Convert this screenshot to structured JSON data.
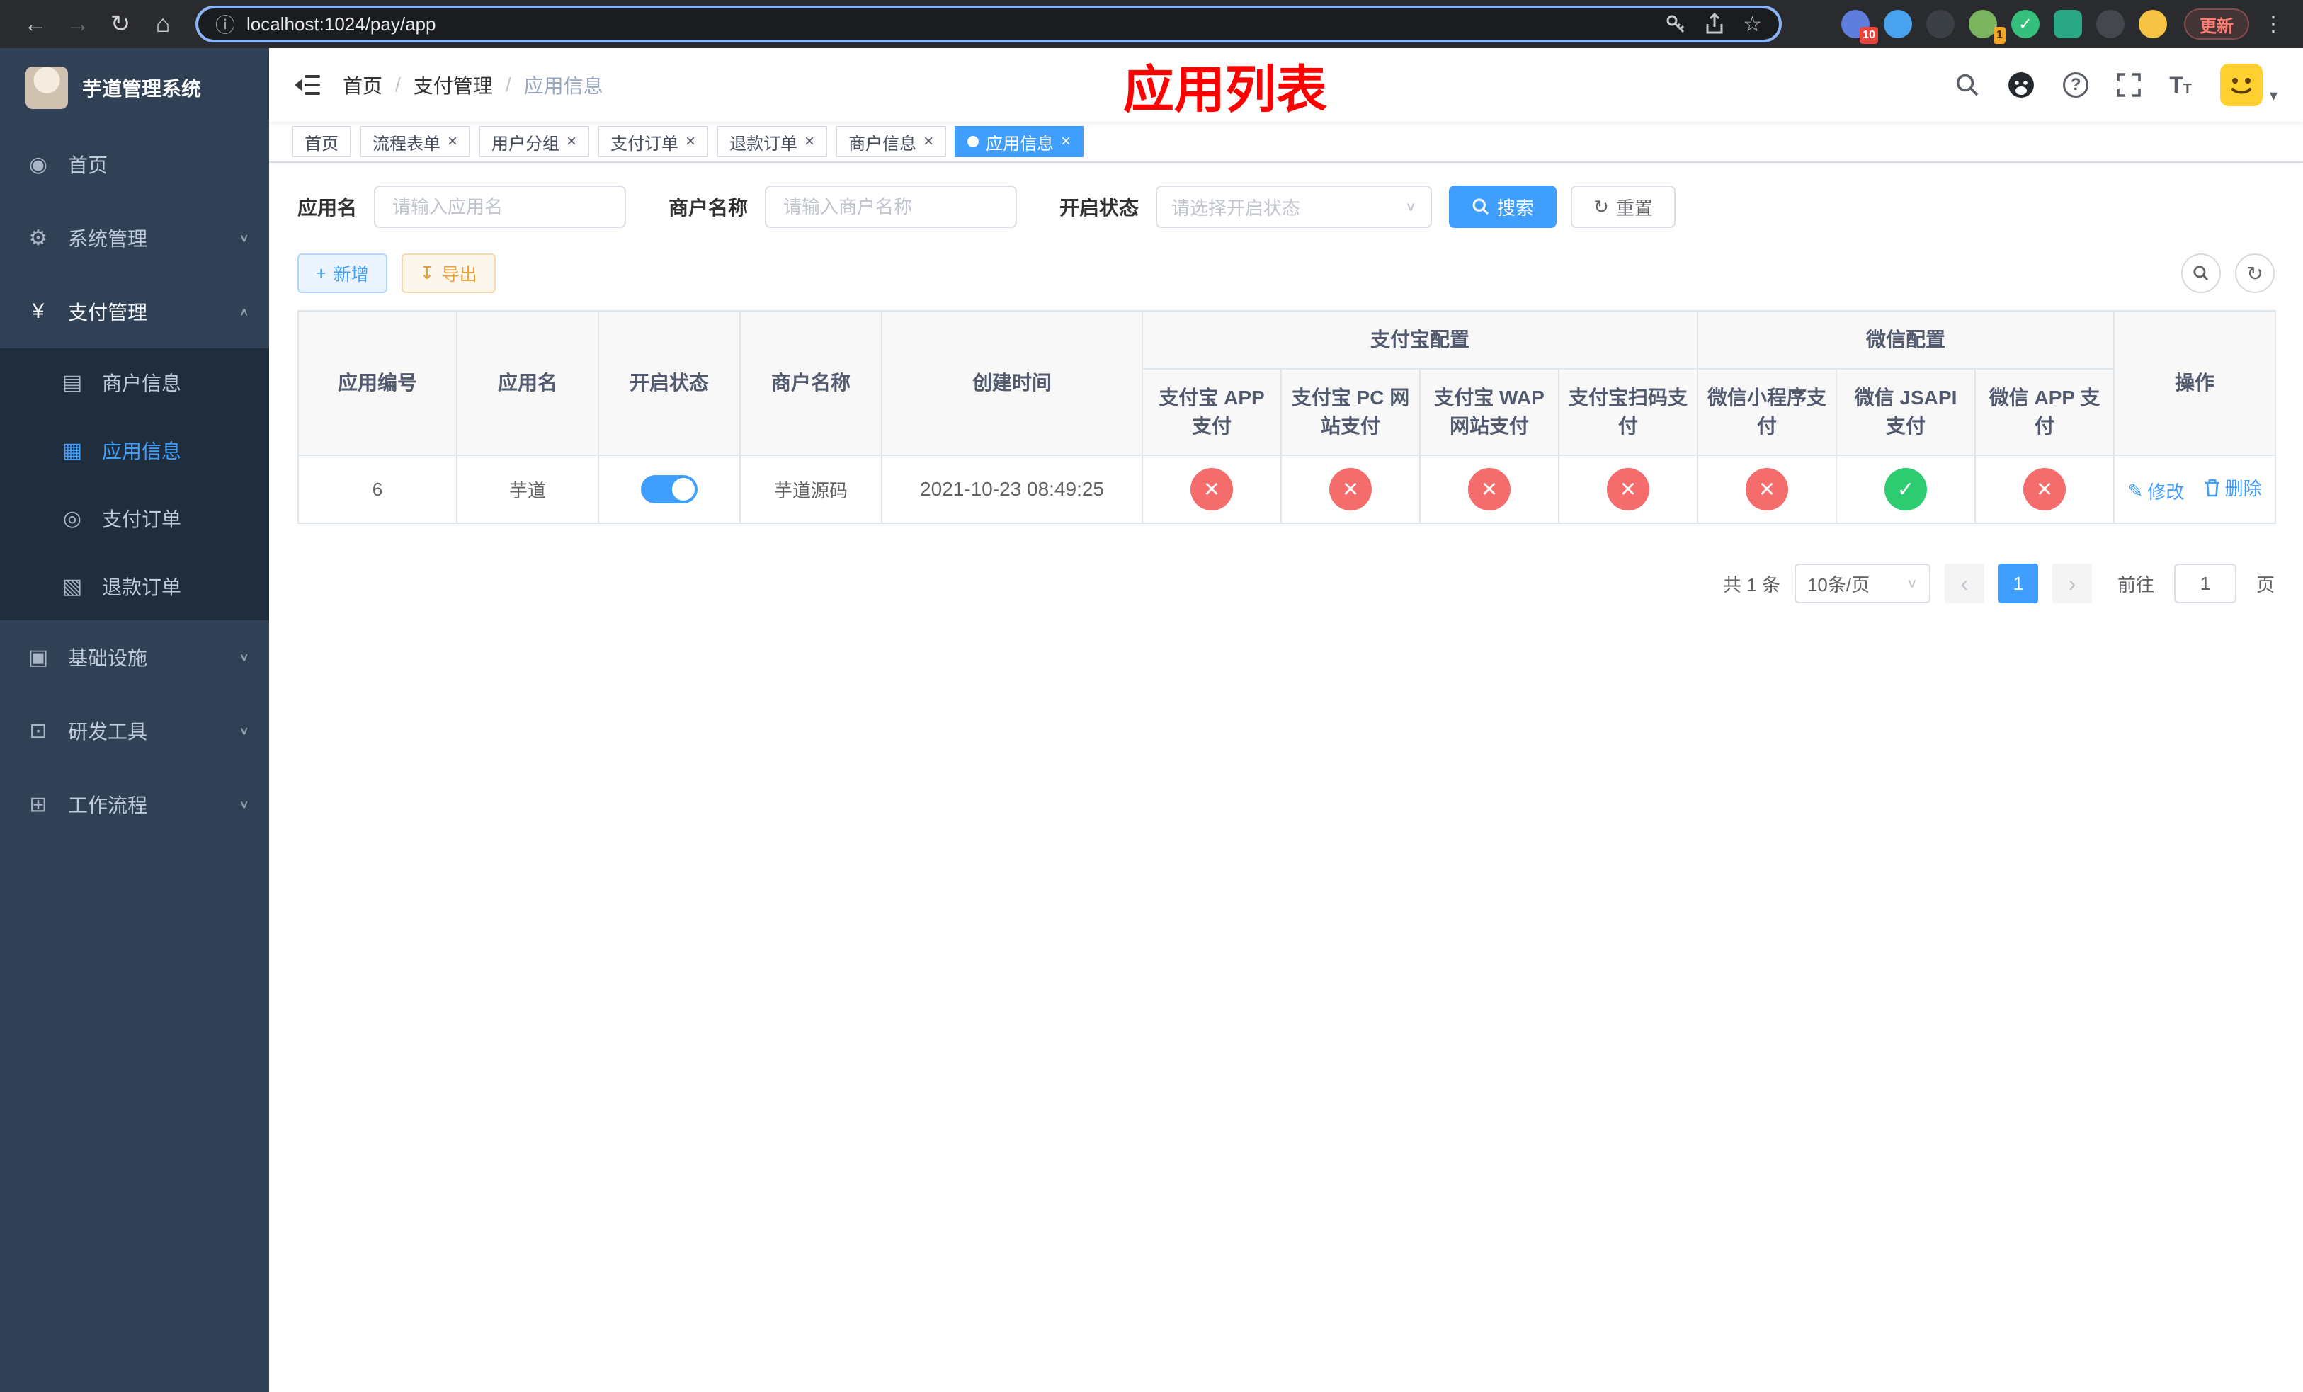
{
  "browser": {
    "url": "localhost:1024/pay/app",
    "update_label": "更新",
    "extension_badge_1": "10",
    "extension_badge_2": "1"
  },
  "sidebar": {
    "logo_title": "芋道管理系统",
    "menu": {
      "home": "首页",
      "system": "系统管理",
      "payment": "支付管理",
      "infra": "基础设施",
      "devtools": "研发工具",
      "workflow": "工作流程"
    },
    "payment_submenu": {
      "merchant": "商户信息",
      "app": "应用信息",
      "order": "支付订单",
      "refund": "退款订单"
    }
  },
  "navbar": {
    "breadcrumb": [
      "首页",
      "支付管理",
      "应用信息"
    ],
    "page_title": "应用列表"
  },
  "tabs": [
    {
      "label": "首页"
    },
    {
      "label": "流程表单"
    },
    {
      "label": "用户分组"
    },
    {
      "label": "支付订单"
    },
    {
      "label": "退款订单"
    },
    {
      "label": "商户信息"
    },
    {
      "label": "应用信息"
    }
  ],
  "filters": {
    "app_name_label": "应用名",
    "app_name_placeholder": "请输入应用名",
    "merchant_label": "商户名称",
    "merchant_placeholder": "请输入商户名称",
    "status_label": "开启状态",
    "status_placeholder": "请选择开启状态",
    "search_label": "搜索",
    "reset_label": "重置"
  },
  "toolbar": {
    "add_label": "新增",
    "export_label": "导出"
  },
  "table": {
    "headers": {
      "id": "应用编号",
      "name": "应用名",
      "status": "开启状态",
      "merchant": "商户名称",
      "created": "创建时间",
      "alipay_group": "支付宝配置",
      "wechat_group": "微信配置",
      "actions": "操作"
    },
    "sub_headers": [
      "支付宝 APP 支付",
      "支付宝 PC 网站支付",
      "支付宝 WAP 网站支付",
      "支付宝扫码支付",
      "微信小程序支付",
      "微信 JSAPI 支付",
      "微信 APP 支付"
    ],
    "rows": [
      {
        "id": "6",
        "name": "芋道",
        "enabled": "on",
        "merchant": "芋道源码",
        "created": "2021-10-23 08:49:25",
        "configs": [
          "cross",
          "cross",
          "cross",
          "cross",
          "cross",
          "check",
          "cross"
        ],
        "edit_label": "修改",
        "delete_label": "删除"
      }
    ]
  },
  "pagination": {
    "total_text": "共 1 条",
    "page_size": "10条/页",
    "current_page": "1",
    "goto_label": "前往",
    "goto_value": "1",
    "page_unit": "页"
  },
  "icons": {
    "dashboard": "◉",
    "gear": "⚙",
    "yen": "¥",
    "card": "▤",
    "grid": "▦",
    "order": "◎",
    "refund": "▧",
    "infra": "▣",
    "tools": "⊡",
    "flow": "⊞",
    "chevron_down": "∨",
    "chevron_up": "∧",
    "back": "←",
    "forward": "→",
    "reload": "↻",
    "home": "⌂",
    "info": "ⓘ",
    "star": "☆",
    "menu_dots": "⋮",
    "caret_down": "▾",
    "plus": "+",
    "download": "↧",
    "reset": "↻",
    "question": "?",
    "font_large": "T",
    "font_small": "T",
    "close": "×",
    "slash": "/",
    "edit": "✎",
    "prev": "‹",
    "next": "›"
  },
  "colors": {
    "accent_blue": "#409eff",
    "danger_red": "#f56c6c",
    "success_green": "#2ecc71",
    "title_red": "#ff0000",
    "sidebar_bg": "#304156",
    "submenu_bg": "#1f2d3d"
  }
}
